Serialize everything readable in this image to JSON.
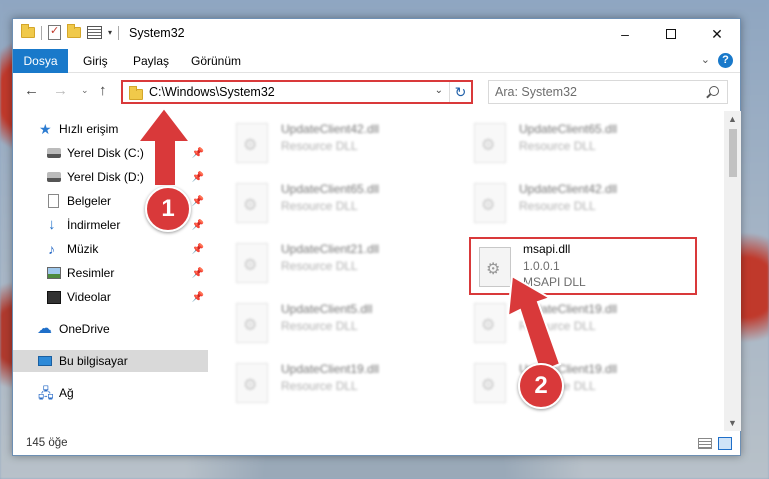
{
  "window": {
    "title": "System32",
    "controls": {
      "minimize": "–",
      "maximize": "",
      "close": "✕"
    }
  },
  "ribbon": {
    "tabs": [
      "Dosya",
      "Giriş",
      "Paylaş",
      "Görünüm"
    ],
    "help": "?"
  },
  "navigation": {
    "address": "C:\\Windows\\System32",
    "search_placeholder": "Ara: System32"
  },
  "sidebar": {
    "items": [
      {
        "label": "Hızlı erişim",
        "icon": "quick-access-star-icon",
        "pinned": false
      },
      {
        "label": "Yerel Disk (C:)",
        "icon": "local-disk-icon",
        "pinned": true
      },
      {
        "label": "Yerel Disk (D:)",
        "icon": "local-disk-icon",
        "pinned": true
      },
      {
        "label": "Belgeler",
        "icon": "documents-icon",
        "pinned": true
      },
      {
        "label": "İndirmeler",
        "icon": "downloads-icon",
        "pinned": true
      },
      {
        "label": "Müzik",
        "icon": "music-icon",
        "pinned": true
      },
      {
        "label": "Resimler",
        "icon": "pictures-icon",
        "pinned": true
      },
      {
        "label": "Videolar",
        "icon": "videos-icon",
        "pinned": true
      },
      {
        "label": "OneDrive",
        "icon": "onedrive-cloud-icon",
        "pinned": false
      },
      {
        "label": "Bu bilgisayar",
        "icon": "this-pc-icon",
        "pinned": false,
        "selected": true
      },
      {
        "label": "Ağ",
        "icon": "network-icon",
        "pinned": false
      }
    ]
  },
  "files": {
    "items": [
      {
        "name": "UpdateClient42.dll",
        "desc": "Resource DLL"
      },
      {
        "name": "UpdateClient65.dll",
        "desc": "Resource DLL"
      },
      {
        "name": "UpdateClient65.dll",
        "desc": "Resource DLL"
      },
      {
        "name": "UpdateClient42.dll",
        "desc": "Resource DLL"
      },
      {
        "name": "UpdateClient21.dll",
        "desc": "Resource DLL"
      },
      {
        "name": "UpdateClient5.dll",
        "desc": "Resource DLL"
      },
      {
        "name": "UpdateClient19.dll",
        "desc": "Resource DLL"
      },
      {
        "name": "UpdateClient19.dll",
        "desc": "Resource DLL"
      },
      {
        "name": "UpdateClient19.dll",
        "desc": "Resource DLL"
      }
    ],
    "highlighted": {
      "name": "msapi.dll",
      "version": "1.0.0.1",
      "desc": "MSAPI DLL"
    }
  },
  "status": {
    "count": "145 öğe"
  },
  "annotations": {
    "step1": "1",
    "step2": "2",
    "color": "#d9393a"
  }
}
